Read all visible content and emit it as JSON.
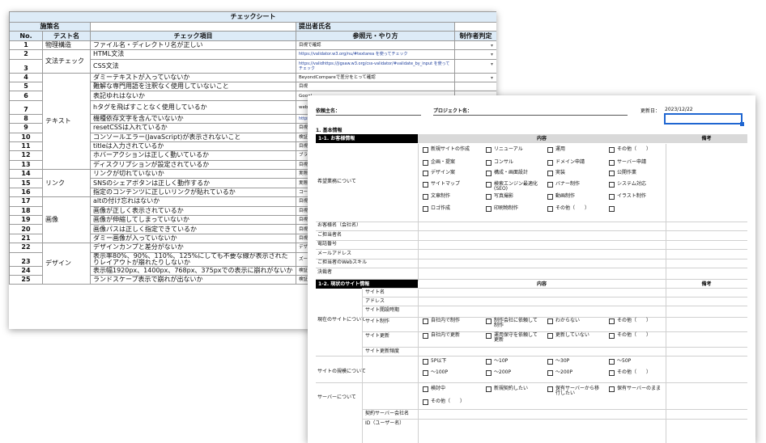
{
  "sheet1": {
    "title": "チェックシート",
    "header1": {
      "measure": "施策名",
      "submitter": "提出者氏名"
    },
    "header2": {
      "no": "No.",
      "test": "テスト名",
      "item": "チェック項目",
      "ref": "参照元・やり方",
      "judge": "制作者判定"
    },
    "rows": [
      {
        "no": "1",
        "cat": "物理構造",
        "item": "ファイル名・ディレクトリ名が正しい",
        "ref": "目視で確認",
        "dd": true
      },
      {
        "no": "2",
        "cat": "文法チェック",
        "item": "HTML文法",
        "ref": "https://validator.w3.org/nu/#textarea を使ってチェック",
        "dd": true,
        "lk": true
      },
      {
        "no": "3",
        "cat": "",
        "item": "CSS文法",
        "ref": "https://validhttps://jigsaw.w3.org/css-validator/#validate_by_input を使ってチェック",
        "dd": true,
        "lk": true
      },
      {
        "no": "4",
        "cat": "テキスト",
        "item": "ダミーテキストが入っていないか",
        "ref": "BeyondCompareで差分をとって確認",
        "dd": true
      },
      {
        "no": "5",
        "cat": "",
        "item": "難解な専門用語を注釈なく使用していないこと",
        "ref": "目視",
        "dd": false
      },
      {
        "no": "6",
        "cat": "",
        "item": "表記ゆれはないか",
        "ref": "Googl",
        "dd": false
      },
      {
        "no": "7",
        "cat": "",
        "item": "hタグを飛ばすことなく使用しているか",
        "ref": "webD hタグ",
        "dd": false
      },
      {
        "no": "8",
        "cat": "",
        "item": "機種依存文字を含んでいないか",
        "ref": "https:",
        "dd": false,
        "lk": true
      },
      {
        "no": "9",
        "cat": "",
        "item": "resetCSSは入れているか",
        "ref": "目視",
        "dd": false
      },
      {
        "no": "10",
        "cat": "",
        "item": "コンソールエラー(JavaScript)が表示されないこと",
        "ref": "検証",
        "dd": false
      },
      {
        "no": "11",
        "cat": "",
        "item": "titleは入力されているか",
        "ref": "目視",
        "dd": false
      },
      {
        "no": "12",
        "cat": "",
        "item": "ホバーアクションは正しく動いているか",
        "ref": "ブラウ",
        "dd": false
      },
      {
        "no": "13",
        "cat": "",
        "item": "ディスクリプションが設定されているか",
        "ref": "目視",
        "dd": false
      },
      {
        "no": "14",
        "cat": "リンク",
        "item": "リンクが切れていないか",
        "ref": "実際",
        "dd": false
      },
      {
        "no": "15",
        "cat": "",
        "item": "SNSのシェアボタンは正しく動作するか",
        "ref": "実際",
        "dd": false
      },
      {
        "no": "16",
        "cat": "",
        "item": "指定のコンテンツに正しいリンクが貼れているか",
        "ref": "コード",
        "dd": false
      },
      {
        "no": "17",
        "cat": "画像",
        "item": "altの付け忘れはないか",
        "ref": "目視",
        "dd": false
      },
      {
        "no": "18",
        "cat": "",
        "item": "画像が正しく表示されているか",
        "ref": "目視",
        "dd": false
      },
      {
        "no": "19",
        "cat": "",
        "item": "画像が伸縮してしまっていないか",
        "ref": "目視",
        "dd": false
      },
      {
        "no": "20",
        "cat": "",
        "item": "画像パスは正しく指定できているか",
        "ref": "目視",
        "dd": false
      },
      {
        "no": "21",
        "cat": "",
        "item": "ダミー画像が入っていないか",
        "ref": "目視",
        "dd": false
      },
      {
        "no": "22",
        "cat": "デザイン",
        "item": "デザインカンプと差分がないか",
        "ref": "デザ",
        "dd": false
      },
      {
        "no": "23",
        "cat": "",
        "item": "表示率80%、90%、110%、125%にしても不要な線が表示されたりレイアウトが崩れたりしないか",
        "ref": "ズー",
        "dd": false
      },
      {
        "no": "24",
        "cat": "",
        "item": "表示幅1920px、1400px、768px、375pxでの表示に崩れがないか",
        "ref": "検証",
        "dd": false
      },
      {
        "no": "25",
        "cat": "",
        "item": "ランドスケープ表示で崩れが出ないか",
        "ref": "検証",
        "dd": false
      }
    ]
  },
  "sheet2": {
    "client_label": "依頼主名：",
    "project_label": "プロジェクト名：",
    "updated_label": "更新日：",
    "updated_value": "2023/12/22",
    "section1": "1. 基本情報",
    "bar1": "1-1. お客様情報",
    "content_header": "内容",
    "remarks_header": "備考",
    "desired_label": "希望業務について",
    "desired_options": [
      "新規サイトの作成",
      "リニューアル",
      "運用",
      "その他（　　）",
      "企画・提案",
      "コンサル",
      "ドメイン申請",
      "サーバー申請",
      "デザイン案",
      "構成・画面設計",
      "実装",
      "公開作業",
      "サイトマップ",
      "検索エンジン最適化(SEO)",
      "バナー制作",
      "システム対応",
      "文章制作",
      "写真撮影",
      "動画制作",
      "イラスト制作",
      "ロゴ作成",
      "印刷物制作",
      "その他（　　）",
      ""
    ],
    "customer_fields": [
      "お客様名（会社名）",
      "ご担当者名",
      "電話番号",
      "メールアドレス",
      "ご担当者のWebスキル",
      "決裁者"
    ],
    "bar2": "1-2. 現状のサイト情報",
    "current_site_label": "現在のサイトについて",
    "site_fields": [
      "サイト名",
      "アドレス",
      "サイト開設時期",
      "サイト制作",
      "サイト更新",
      "サイト更新頻度"
    ],
    "production_options": [
      "自社内で制作",
      "制作会社に依頼して制作",
      "わからない",
      "その他（　　）"
    ],
    "update_options": [
      "自社内で更新",
      "運用保守を依頼して更新",
      "更新していない",
      "その他（　　）"
    ],
    "scale_label": "サイトの規模について",
    "scale_options": [
      "5P以下",
      "～10P",
      "～30P",
      "～50P",
      "～100P",
      "～200P",
      "～200P",
      "その他（　　）"
    ],
    "server_label": "サーバーについて",
    "server_options": [
      "検討中",
      "新規契約したい",
      "保有サーバーから移行したい",
      "保有サーバーのまま",
      "その他（　　）"
    ],
    "server_fields": [
      "契約サーバー会社名",
      "ID（ユーザー名）"
    ]
  }
}
